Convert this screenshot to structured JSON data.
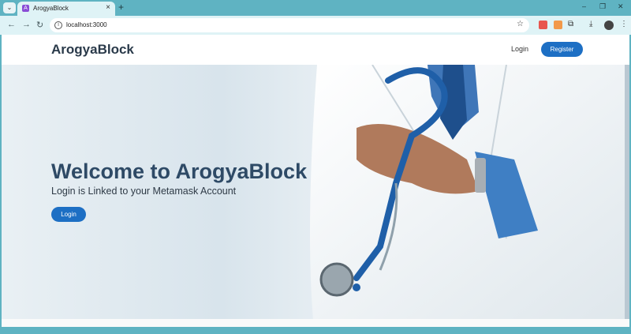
{
  "browser": {
    "tab_title": "ArogyaBlock",
    "tab_favicon": "A",
    "close_glyph": "×",
    "new_tab_glyph": "+",
    "url": "localhost:3000",
    "minimize_glyph": "–",
    "restore_glyph": "❐",
    "close_window_glyph": "✕",
    "back_glyph": "←",
    "forward_glyph": "→",
    "reload_glyph": "↻",
    "star_glyph": "☆",
    "download_glyph": "⤓",
    "puzzle_glyph": "⧉",
    "menu_glyph": "⋮",
    "tab_menu_glyph": "⌄",
    "info_glyph": "i"
  },
  "navbar": {
    "brand": "ArogyaBlock",
    "login_label": "Login",
    "register_label": "Register"
  },
  "hero": {
    "title": "Welcome to ArogyaBlock",
    "subtitle": "Login is Linked to your Metamask Account",
    "login_label": "Login"
  },
  "colors": {
    "brand_primary": "#1d6fc4",
    "heading": "#2e4a66",
    "chrome_accent": "#5fb3c2"
  }
}
